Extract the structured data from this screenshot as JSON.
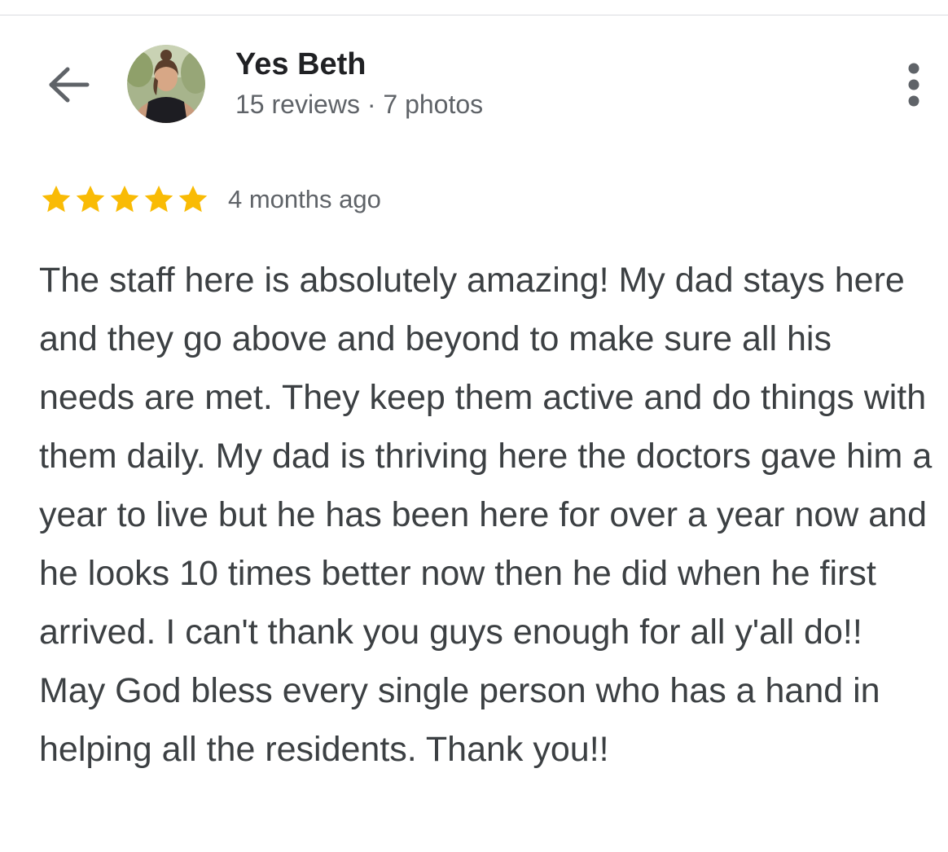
{
  "reviewer": {
    "name": "Yes Beth",
    "meta": "15 reviews · 7 photos"
  },
  "review": {
    "rating": 5,
    "rating_max": 5,
    "date": "4 months ago",
    "text": "The staff here is absolutely amazing! My dad stays here and they go above and beyond to make sure all his needs are met. They keep them active and do things with them daily. My dad is thriving here the doctors gave him a year to live but he has been here for over a year now and he looks 10 times better now then he did when he first arrived. I can't thank you guys enough for all y'all do!! May God bless every single person who has a hand in helping all the residents. Thank you!!"
  },
  "icons": {
    "back": "arrow-back-icon",
    "more": "more-vertical-icon",
    "star": "star-icon"
  },
  "colors": {
    "star": "#f9bb05",
    "name": "#202124",
    "secondary": "#5f6368",
    "body": "#3c4043",
    "icon": "#5f6368"
  }
}
